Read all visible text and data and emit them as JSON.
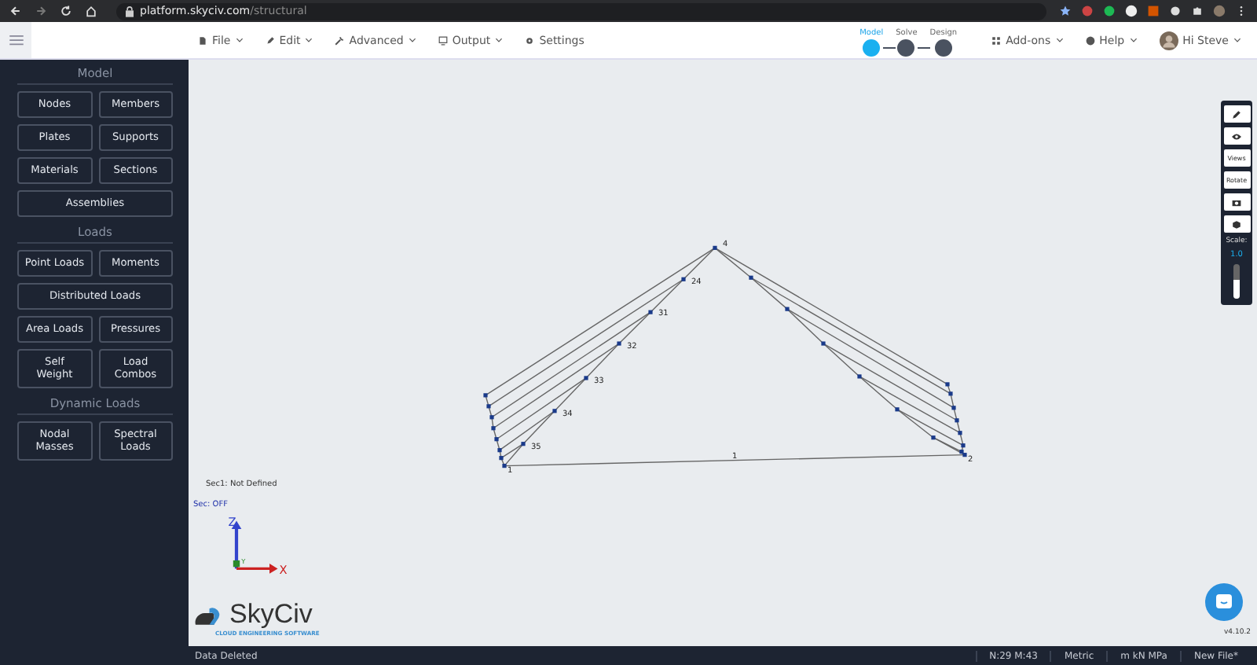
{
  "browser": {
    "url_host": "platform.skyciv.com",
    "url_path": "/structural"
  },
  "menus": [
    {
      "label": "File",
      "dropdown": true
    },
    {
      "label": "Edit",
      "dropdown": true
    },
    {
      "label": "Advanced",
      "dropdown": true
    },
    {
      "label": "Output",
      "dropdown": true
    },
    {
      "label": "Settings",
      "dropdown": false
    }
  ],
  "workflow": [
    {
      "label": "Model",
      "selected": true
    },
    {
      "label": "Solve",
      "selected": false
    },
    {
      "label": "Design",
      "selected": false
    }
  ],
  "right_menus": [
    {
      "label": "Add-ons"
    },
    {
      "label": "Help"
    }
  ],
  "user": {
    "greeting": "Hi Steve"
  },
  "sidebar": [
    {
      "title": "Model",
      "buttons": [
        {
          "label": "Nodes",
          "kind": "half"
        },
        {
          "label": "Members",
          "kind": "half"
        },
        {
          "label": "Plates",
          "kind": "half"
        },
        {
          "label": "Supports",
          "kind": "half"
        },
        {
          "label": "Materials",
          "kind": "half"
        },
        {
          "label": "Sections",
          "kind": "half"
        },
        {
          "label": "Assemblies",
          "kind": "wide"
        }
      ]
    },
    {
      "title": "Loads",
      "buttons": [
        {
          "label": "Point Loads",
          "kind": "half"
        },
        {
          "label": "Moments",
          "kind": "half"
        },
        {
          "label": "Distributed Loads",
          "kind": "wide"
        },
        {
          "label": "Area Loads",
          "kind": "half"
        },
        {
          "label": "Pressures",
          "kind": "half"
        },
        {
          "label": "Self Weight",
          "kind": "tall"
        },
        {
          "label": "Load Combos",
          "kind": "tall"
        }
      ]
    },
    {
      "title": "Dynamic Loads",
      "buttons": [
        {
          "label": "Nodal Masses",
          "kind": "tall"
        },
        {
          "label": "Spectral Loads",
          "kind": "tall"
        }
      ]
    }
  ],
  "canvas": {
    "section_note": "Sec1: Not Defined",
    "section_toggle": "Sec: OFF",
    "axes": [
      "Z",
      "Y",
      "X"
    ],
    "node_labels": [
      "4",
      "24",
      "31",
      "32",
      "33",
      "34",
      "35",
      "1",
      "2"
    ],
    "member_labels": [
      "1"
    ],
    "logo": {
      "name": "SkyCiv",
      "tagline": "CLOUD ENGINEERING SOFTWARE"
    },
    "version": "v4.10.2"
  },
  "view_tools": {
    "buttons": [
      "Views",
      "Rotate"
    ],
    "scale": {
      "label": "Scale:",
      "value": "1.0",
      "level": 0.55
    }
  },
  "status_bar": {
    "message": "Data Deleted",
    "counts": "N:29 M:43",
    "system": "Metric",
    "units": "m kN MPa",
    "file": "New File*"
  }
}
